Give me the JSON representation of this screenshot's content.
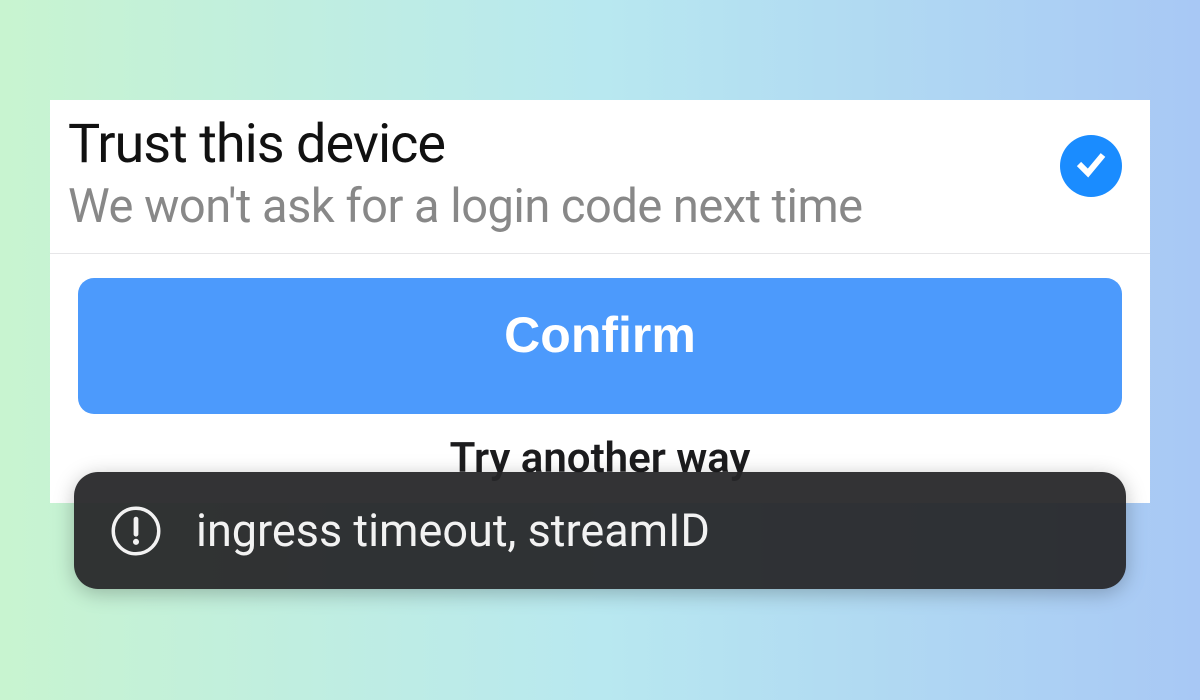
{
  "trust": {
    "title": "Trust this device",
    "subtitle": "We won't ask for a login code next time"
  },
  "buttons": {
    "confirm": "Confirm",
    "secondary": "Try another way"
  },
  "toast": {
    "message": "ingress timeout, streamID"
  },
  "colors": {
    "accent": "#1a8cff",
    "button": "#4c9afc",
    "toast_bg": "rgba(38,38,40,0.94)"
  }
}
